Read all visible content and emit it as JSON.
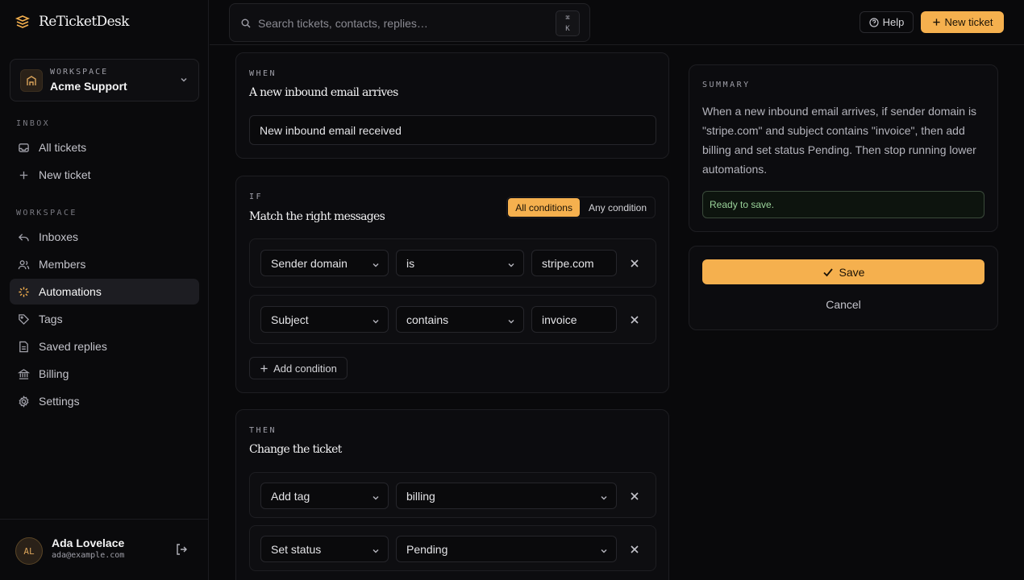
{
  "brand": {
    "name": "ReTicketDesk"
  },
  "workspace": {
    "kicker": "WORKSPACE",
    "name": "Acme Support"
  },
  "sidebar": {
    "inbox_label": "INBOX",
    "inbox_items": [
      {
        "label": "All tickets",
        "icon": "inbox-icon"
      },
      {
        "label": "New ticket",
        "icon": "plus-icon"
      }
    ],
    "workspace_label": "WORKSPACE",
    "workspace_items": [
      {
        "label": "Inboxes",
        "icon": "reply-arrow-icon"
      },
      {
        "label": "Members",
        "icon": "users-icon"
      },
      {
        "label": "Automations",
        "icon": "sparkle-icon",
        "active": true
      },
      {
        "label": "Tags",
        "icon": "tag-icon"
      },
      {
        "label": "Saved replies",
        "icon": "document-icon"
      },
      {
        "label": "Billing",
        "icon": "bank-icon"
      },
      {
        "label": "Settings",
        "icon": "gear-icon"
      }
    ]
  },
  "user": {
    "initials": "AL",
    "name": "Ada Lovelace",
    "email": "ada@example.com"
  },
  "header": {
    "search_placeholder": "Search tickets, contacts, replies…",
    "kbd_top": "⌘",
    "kbd_bottom": "K",
    "help_label": "Help",
    "new_ticket_label": "New ticket"
  },
  "when": {
    "kicker": "WHEN",
    "title": "A new inbound email arrives",
    "trigger": "New inbound email received"
  },
  "if": {
    "kicker": "IF",
    "title": "Match the right messages",
    "mode_all": "All conditions",
    "mode_any": "Any condition",
    "conditions": [
      {
        "field": "Sender domain",
        "operator": "is",
        "value": "stripe.com"
      },
      {
        "field": "Subject",
        "operator": "contains",
        "value": "invoice"
      }
    ],
    "add_label": "Add condition"
  },
  "then": {
    "kicker": "THEN",
    "title": "Change the ticket",
    "actions": [
      {
        "action": "Add tag",
        "value": "billing"
      },
      {
        "action": "Set status",
        "value": "Pending"
      }
    ]
  },
  "summary": {
    "kicker": "SUMMARY",
    "text": "When a new inbound email arrives, if sender domain is \"stripe.com\" and subject contains \"invoice\", then add billing and set status Pending. Then stop running lower automations.",
    "status": "Ready to save."
  },
  "footer_actions": {
    "save_label": "Save",
    "cancel_label": "Cancel"
  },
  "colors": {
    "accent": "#f5b04e",
    "success_text": "#9ad39a"
  }
}
